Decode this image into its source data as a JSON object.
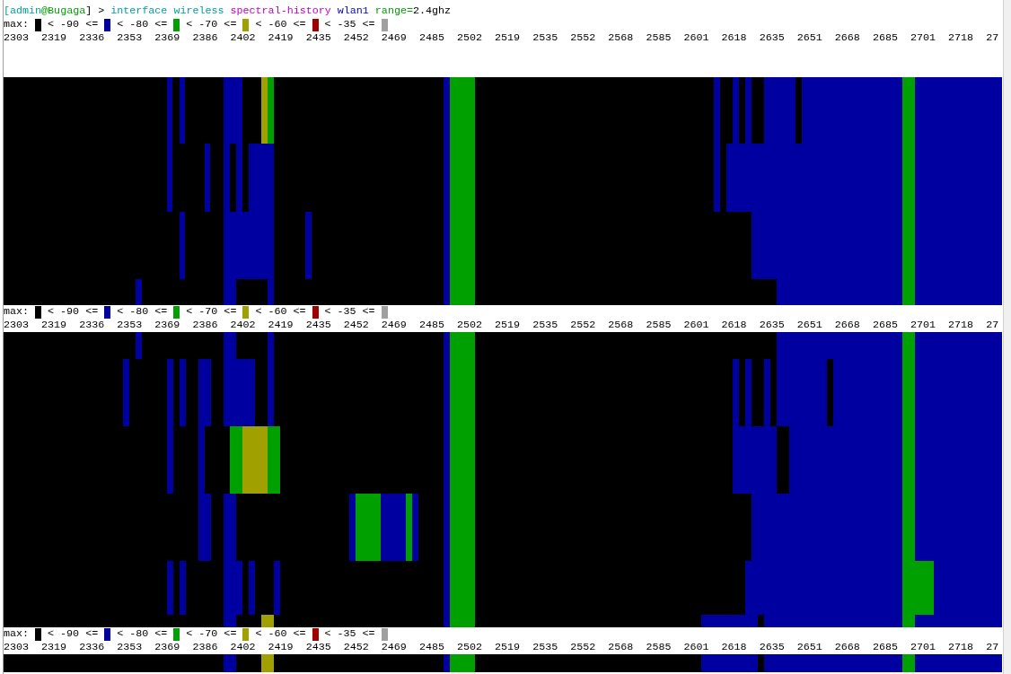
{
  "terminal": {
    "prompt": [
      {
        "parts": [
          {
            "text": "[admin",
            "color": "#00a0a0"
          },
          {
            "text": "@Bugaga",
            "color": "#00a000"
          },
          {
            "text": "]"
          }
        ]
      },
      {
        "parts": [
          {
            "text": ">"
          }
        ]
      },
      {
        "parts": [
          {
            "text": "interface wireless",
            "color": "#00a0a0"
          }
        ]
      },
      {
        "parts": [
          {
            "text": "spectral-history",
            "color": "#c000c0"
          }
        ]
      },
      {
        "parts": [
          {
            "text": "wlan1",
            "color": "#0000c0"
          }
        ]
      },
      {
        "parts": [
          {
            "text": "range=",
            "color": "#00a000"
          },
          {
            "text": "2.4ghz"
          }
        ]
      }
    ],
    "sections": [
      {
        "legend": {
          "prefix": "max:",
          "items": [
            {
              "color": "#000000",
              "label": "< -90 <="
            },
            {
              "color": "#0000a0",
              "label": "< -80 <="
            },
            {
              "color": "#00a000",
              "label": "< -70 <="
            },
            {
              "color": "#a0a000",
              "label": "< -60 <="
            },
            {
              "color": "#a00000",
              "label": "< -35 <="
            },
            {
              "color": "#a0a0a0"
            }
          ]
        },
        "frequencies": "2303  2319  2336  2353  2369  2386  2402  2419  2435  2452  2469  2485  2502  2519  2535  2552  2568  2585  2601  2618  2635  2651  2668  2685  2701  2718  27"
      },
      {
        "legend": {
          "prefix": "max:",
          "items": [
            {
              "color": "#000000",
              "label": "< -90 <="
            },
            {
              "color": "#0000a0",
              "label": "< -80 <="
            },
            {
              "color": "#00a000",
              "label": "< -70 <="
            },
            {
              "color": "#a0a000",
              "label": "< -60 <="
            },
            {
              "color": "#a00000",
              "label": "< -35 <="
            },
            {
              "color": "#a0a0a0"
            }
          ]
        },
        "frequencies": "2303  2319  2336  2353  2369  2386  2402  2419  2435  2452  2469  2485  2502  2519  2535  2552  2568  2585  2601  2618  2635  2651  2668  2685  2701  2718  27"
      },
      {
        "legend": {
          "prefix": "max:",
          "items": [
            {
              "color": "#000000",
              "label": "< -90 <="
            },
            {
              "color": "#0000a0",
              "label": "< -80 <="
            },
            {
              "color": "#00a000",
              "label": "< -70 <="
            },
            {
              "color": "#a0a000",
              "label": "< -60 <="
            },
            {
              "color": "#a00000",
              "label": "< -35 <="
            },
            {
              "color": "#a0a0a0"
            }
          ]
        },
        "frequencies": "2303  2319  2336  2353  2369  2386  2402  2419  2435  2452  2469  2485  2502  2519  2535  2552  2568  2585  2601  2618  2635  2651  2668  2685  2701  2718  27"
      }
    ]
  }
}
